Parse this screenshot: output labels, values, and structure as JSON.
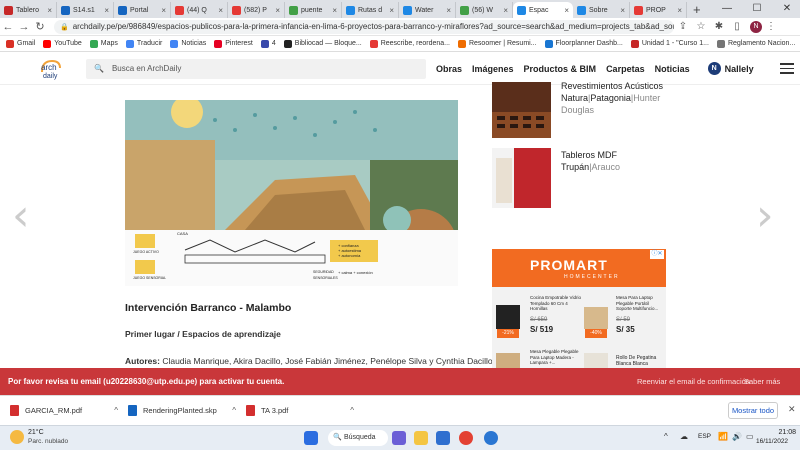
{
  "browser": {
    "tabs": [
      {
        "title": "Tablero",
        "color": "#c62828"
      },
      {
        "title": "S14.s1",
        "color": "#1565c0"
      },
      {
        "title": "Portal",
        "color": "#1565c0"
      },
      {
        "title": "(44) Q",
        "color": "#e53935"
      },
      {
        "title": "(582) P",
        "color": "#e53935"
      },
      {
        "title": "puente",
        "color": "#43a047"
      },
      {
        "title": "Rutas d",
        "color": "#1e88e5"
      },
      {
        "title": "Water",
        "color": "#1e88e5"
      },
      {
        "title": "(56) W",
        "color": "#43a047"
      },
      {
        "title": "Espac",
        "color": "#1e88e5"
      },
      {
        "title": "Sobre",
        "color": "#1e88e5"
      },
      {
        "title": "PROP",
        "color": "#e53935"
      }
    ],
    "active_tab_index": 9,
    "url": "archdaily.pe/pe/986849/espacios-publicos-para-la-primera-infancia-en-lima-6-proyectos-para-barranco-y-miraflores?ad_source=search&ad_medium=projects_tab&ad_source=search&...",
    "profile_initial": "N",
    "bookmarks": [
      {
        "label": "Gmail",
        "color": "#d93025"
      },
      {
        "label": "YouTube",
        "color": "#ff0000"
      },
      {
        "label": "Maps",
        "color": "#34a853"
      },
      {
        "label": "Traducir",
        "color": "#4285f4"
      },
      {
        "label": "Noticias",
        "color": "#4285f4"
      },
      {
        "label": "Pinterest",
        "color": "#e60023"
      },
      {
        "label": "4",
        "color": "#3949ab"
      },
      {
        "label": "Bibliocad — Bloque...",
        "color": "#222222"
      },
      {
        "label": "Reescribe, reordena...",
        "color": "#e53935"
      },
      {
        "label": "Resoomer | Resumi...",
        "color": "#ef6c00"
      },
      {
        "label": "Floorplanner Dashb...",
        "color": "#1976d2"
      },
      {
        "label": "Unidad 1 - \"Curso 1...",
        "color": "#c62828"
      },
      {
        "label": "Reglamento Nacion...",
        "color": "#757575"
      }
    ]
  },
  "site": {
    "logo_text": "archdaily",
    "search_placeholder": "Busca en ArchDaily",
    "nav": [
      "Obras",
      "Imágenes",
      "Productos & BIM",
      "Carpetas",
      "Noticias"
    ],
    "user_name": "Nallely",
    "user_initial": "N"
  },
  "article": {
    "diagram_labels": {
      "caja": "CASA",
      "plus1": "+ confianza",
      "plus2": "+ autoestima",
      "plus3": "+ autonomía",
      "plus4": "+ calma + conexión",
      "juego_activo": "JUEGO ACTIVO",
      "juego_sensorial": "JUEGO SENSORIAL",
      "seguridad": "SEGURIDAD",
      "sensoriales": "SENSORIALES"
    },
    "project_title": "Intervención Barranco - Malambo",
    "award": "Primer lugar / Espacios de aprendizaje",
    "authors_label": "Autores:",
    "authors": "Claudia Manrique, Akira Dacillo, José Fabián Jiménez, Penélope Silva y Cynthia Dacillo"
  },
  "sidebar": {
    "products": [
      {
        "title_partial": "Revestimientos Acústicos",
        "title2": "Natura",
        "brand": "Patagonia",
        "brand2": "Hunter Douglas"
      },
      {
        "title_partial": "Tableros MDF Trupán",
        "brand": "Arauco"
      }
    ],
    "ad": {
      "brand": "PROMART",
      "brand_sub": "HOMECENTER",
      "items": [
        {
          "name": "Cocina Empotrable Vidrio Templado 60 Cm 4 Hornillas",
          "old_price": "S/ 659",
          "price": "S/ 519",
          "discount": "-21%"
        },
        {
          "name": "Mesa Para Laptop Plegable Portátil Soporte Multifuncio...",
          "old_price": "S/ 59",
          "price": "S/ 35",
          "discount": "-40%"
        },
        {
          "name": "Mesa Plegable Plegable Para Laptop Madera - Lampara +...",
          "old_price": "",
          "price": "",
          "discount": ""
        },
        {
          "name": "Rollo De Pegatina Blanca Blanca",
          "old_price": "",
          "price": "",
          "discount": ""
        }
      ]
    }
  },
  "banner": {
    "message": "Por favor revisa tu email (u20228630@utp.edu.pe) para activar tu cuenta.",
    "resend": "Reenviar el email de confirmación",
    "more": "Saber más"
  },
  "downloads": {
    "files": [
      {
        "name": "GARCIA_RM.pdf",
        "color": "#d32f2f"
      },
      {
        "name": "RenderingPlanted.skp",
        "color": "#1565c0"
      },
      {
        "name": "TA 3.pdf",
        "color": "#d32f2f"
      }
    ],
    "show_all": "Mostrar todo"
  },
  "taskbar": {
    "weather_temp": "21°C",
    "weather_desc": "Parc. nublado",
    "search_label": "Búsqueda",
    "lang": "ESP",
    "time": "21:08",
    "date": "16/11/2022"
  }
}
